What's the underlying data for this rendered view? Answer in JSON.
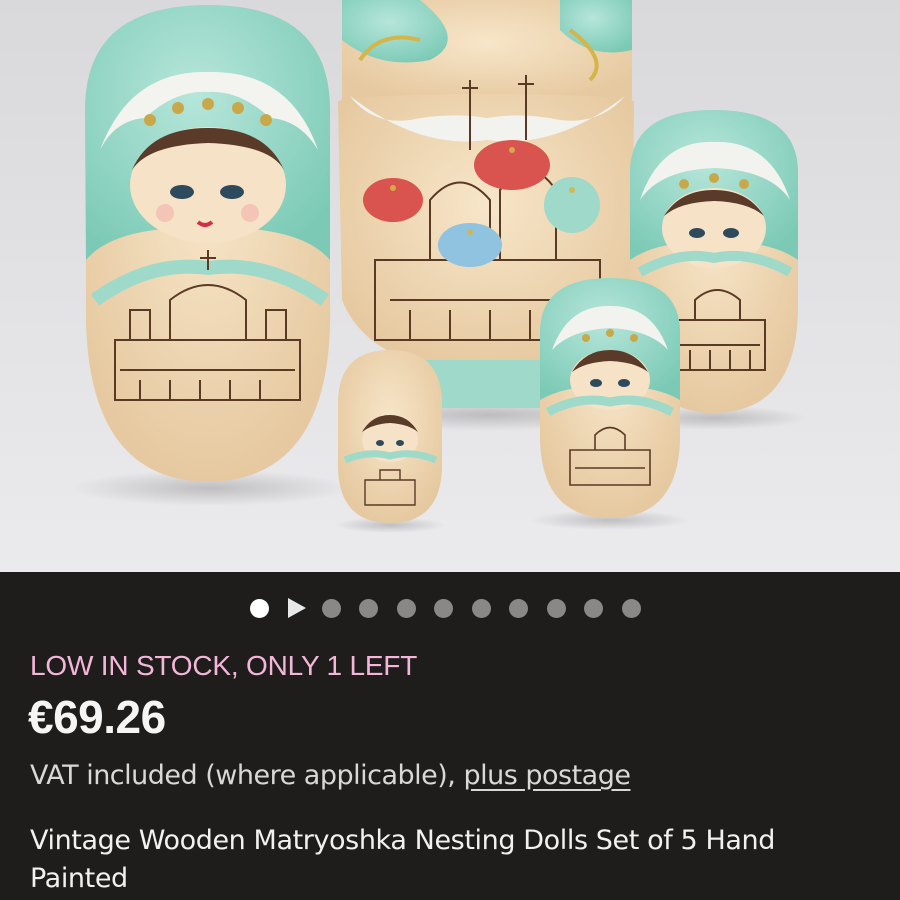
{
  "gallery": {
    "image_alt": "Five wooden nesting dolls painted with turquoise headscarves and churches",
    "slide_count": 11,
    "active_index": 0,
    "video_indicator_index": 1
  },
  "listing": {
    "stock_notice": "LOW IN STOCK, ONLY 1 LEFT",
    "price": "€69.26",
    "vat_text": "VAT included (where applicable), ",
    "postage_link": "plus postage",
    "title": "Vintage Wooden Matryoshka Nesting Dolls Set of 5 Hand Painted"
  },
  "colors": {
    "stock_notice": "#f4b6d8",
    "background": "#1f1d1c",
    "turquoise": "#9fd9c9",
    "wood": "#f0d9b5"
  }
}
